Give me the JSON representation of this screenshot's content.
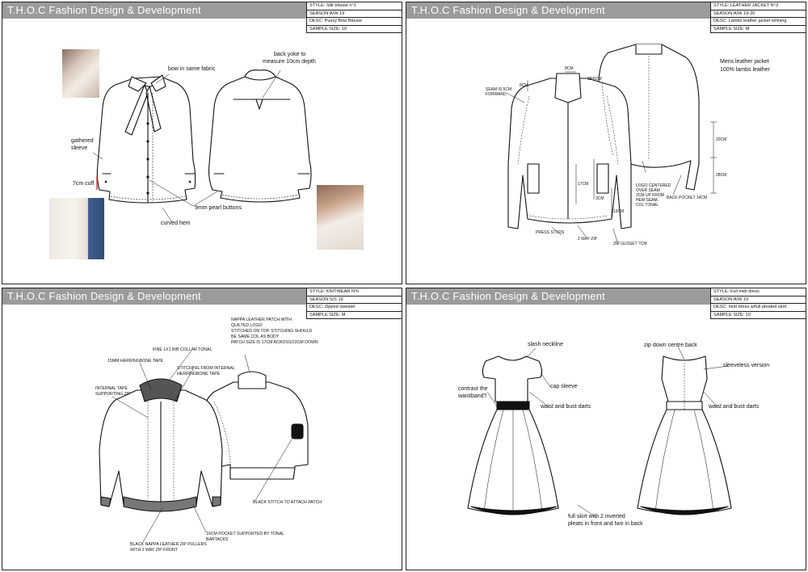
{
  "header_title": "T.H.O.C Fashion Design & Development",
  "sheets": [
    {
      "spec": [
        "STYLE: Silk blouse n°1",
        "SEASON:A/W 19",
        "DESC: Pussy Bow Blouse",
        "SAMPLE SIZE: 10"
      ],
      "labels": [
        "bow in same fabric",
        "back yoke to",
        "measure 10cm depth",
        "gathered",
        "sleeve",
        "7cm cuff",
        "9mm pearl buttons",
        "curved hem"
      ]
    },
    {
      "spec": [
        "STYLE: LEATHER JACKET N°3",
        "SEASON:A/W 19-20",
        "DESC: Lambs leather jacket w/lining",
        "SAMPLE SIZE: M"
      ],
      "labels": [
        "Mens leather jacket",
        "100% lambs leather",
        "SEAM IS 5CM",
        "FORWARD",
        "8CM",
        "8CM",
        "22.5CM",
        "20CM",
        "28CM",
        "LOGO CENTERED",
        "OVER SEAM",
        "2CM UP FROM",
        "HEM SEAM.",
        "COL TONAL",
        "BACK POCKET 14CM",
        "17CM",
        "3CM",
        "13CM",
        "PRESS STUDS",
        "2 WAY ZIP",
        "ZIP GUSSET 7CM"
      ]
    },
    {
      "spec": [
        "STYLE: KNITWEAR N°6",
        "SEASON:S/S 19",
        "DESC: Zipped sweater",
        "SAMPLE SIZE: M"
      ],
      "labels": [
        "NAPPA LEATHER PATCH WITH",
        "QUILTED LOGO",
        "STITCHED ON TOP. STITCHING SHOULD",
        "BE SAME COL AS BODY",
        "PATCH SIZE IS 17CM ACROSS/22CM DOWN",
        "FINE 1X1 RIB COLLAR TONAL",
        "15MM HERRINGBONE TAPE",
        "STITCHING FROM INTERNAL",
        "HERRINGBONE TAPE",
        "INTERNAL TAPE",
        "SUPPORTING ZIP",
        "BLACK STITCH TO ATTACH PATCH",
        "16CM POCKET SUPPORTED BY TONAL",
        "BARTACKS",
        "BLACK NAPPA LEATHER ZIP PULLERS",
        "WITH 2 WAY ZIP FRONT"
      ]
    },
    {
      "spec": [
        "STYLE: Full midi dress",
        "SEASON:A/W 19",
        "DESC: midi dress w/full pleated skirt",
        "SAMPLE SIZE: 10"
      ],
      "labels": [
        "slash neckline",
        "zip down centre back",
        "sleeveless version",
        "contrast the",
        "waistband?",
        "cap sleeve",
        "waist and bust darts",
        "waist and bust darts",
        "full skirt with 2 inverted",
        "pleats in front and two in back"
      ]
    }
  ]
}
